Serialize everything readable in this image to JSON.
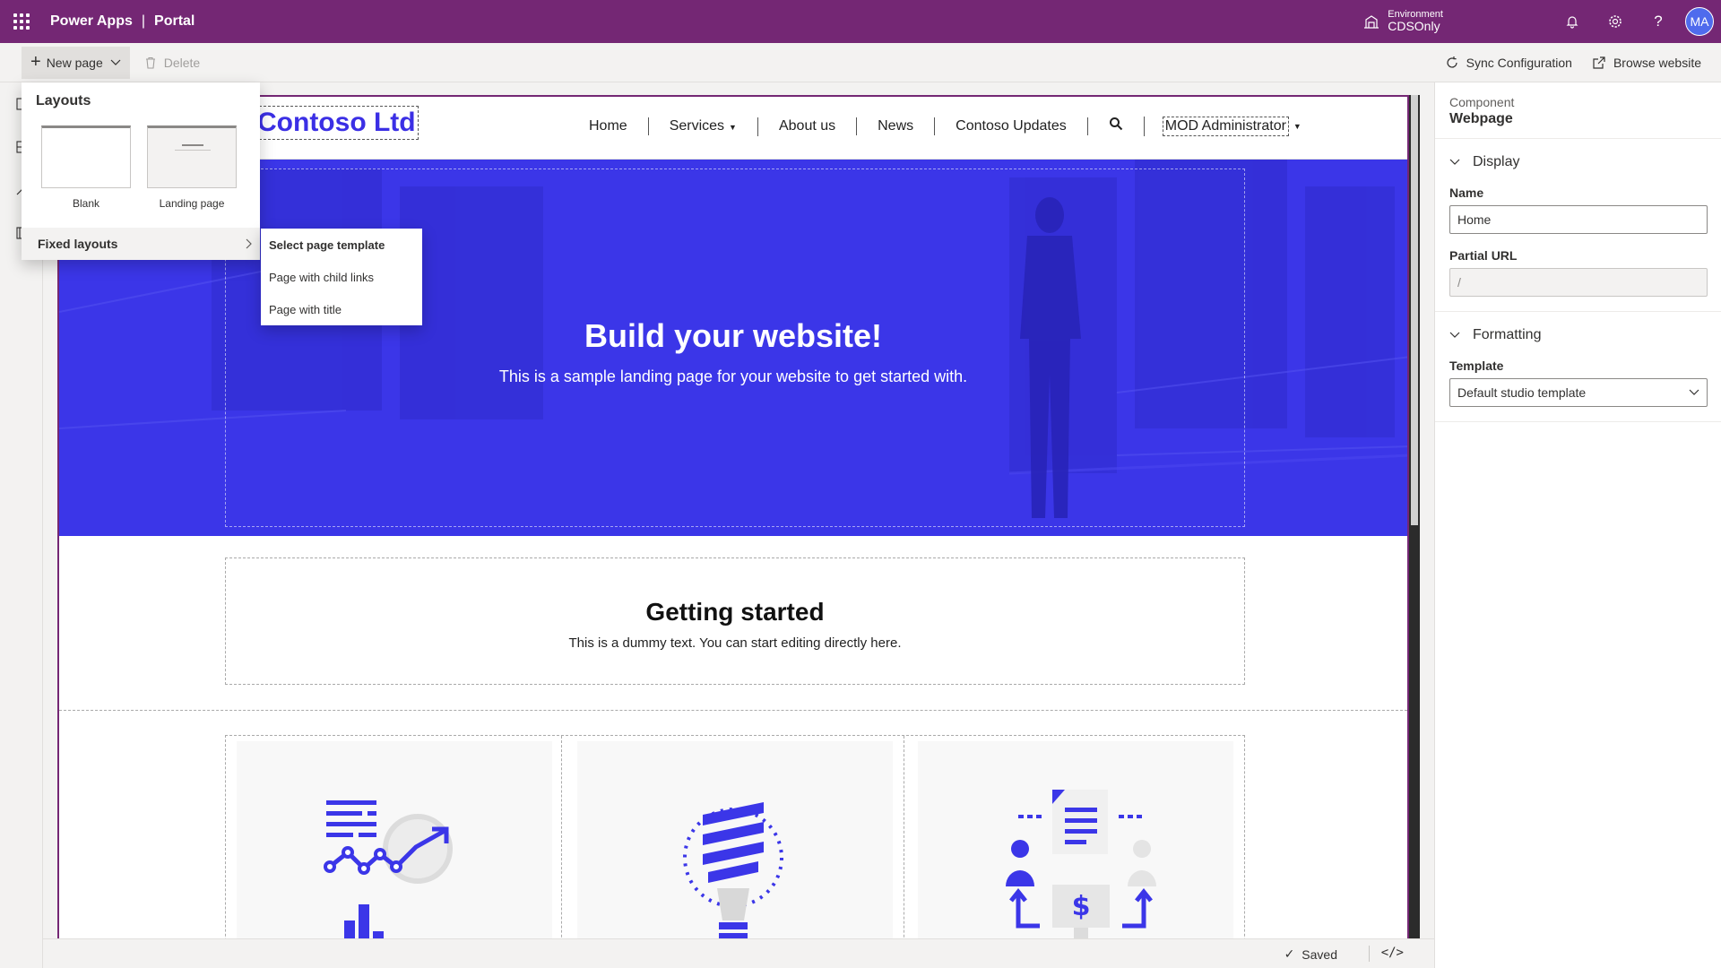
{
  "topbar": {
    "app_name": "Power Apps",
    "separator": "|",
    "product": "Portal",
    "environment_label": "Environment",
    "environment_name": "CDSOnly",
    "user_initials": "MA"
  },
  "commandbar": {
    "new_page": "New page",
    "delete": "Delete",
    "sync": "Sync Configuration",
    "browse": "Browse website"
  },
  "site": {
    "logo": "Contoso Ltd",
    "nav": [
      "Home",
      "Services",
      "About us",
      "News",
      "Contoso Updates"
    ],
    "user": "MOD Administrator",
    "hero_title": "Build your website!",
    "hero_subtitle": "This is a sample landing page for your website to get started with.",
    "section_title": "Getting started",
    "section_text": "This is a dummy text. You can start editing directly here."
  },
  "flyout": {
    "title": "Layouts",
    "layouts": [
      "Blank",
      "Landing page"
    ],
    "fixed_layouts": "Fixed layouts",
    "submenu": [
      "Select page template",
      "Page with child links",
      "Page with title"
    ]
  },
  "panel": {
    "component_label": "Component",
    "component_name": "Webpage",
    "display_section": "Display",
    "name_label": "Name",
    "name_value": "Home",
    "url_label": "Partial URL",
    "url_value": "/",
    "formatting_section": "Formatting",
    "template_label": "Template",
    "template_value": "Default studio template"
  },
  "status": {
    "saved": "Saved",
    "code_toggle": "</>"
  },
  "colors": {
    "brand": "#742774",
    "hero": "#3b36e8",
    "logo": "#3b2fe5"
  },
  "icons": {
    "topbar": [
      "waffle-icon",
      "environment-icon",
      "bell-icon",
      "gear-icon",
      "help-icon"
    ],
    "commandbar": [
      "plus-icon",
      "chevron-down-icon",
      "trash-icon",
      "sync-icon",
      "external-link-icon"
    ],
    "left_rail": [
      "pages-icon",
      "components-icon",
      "themes-icon",
      "templates-icon"
    ]
  }
}
